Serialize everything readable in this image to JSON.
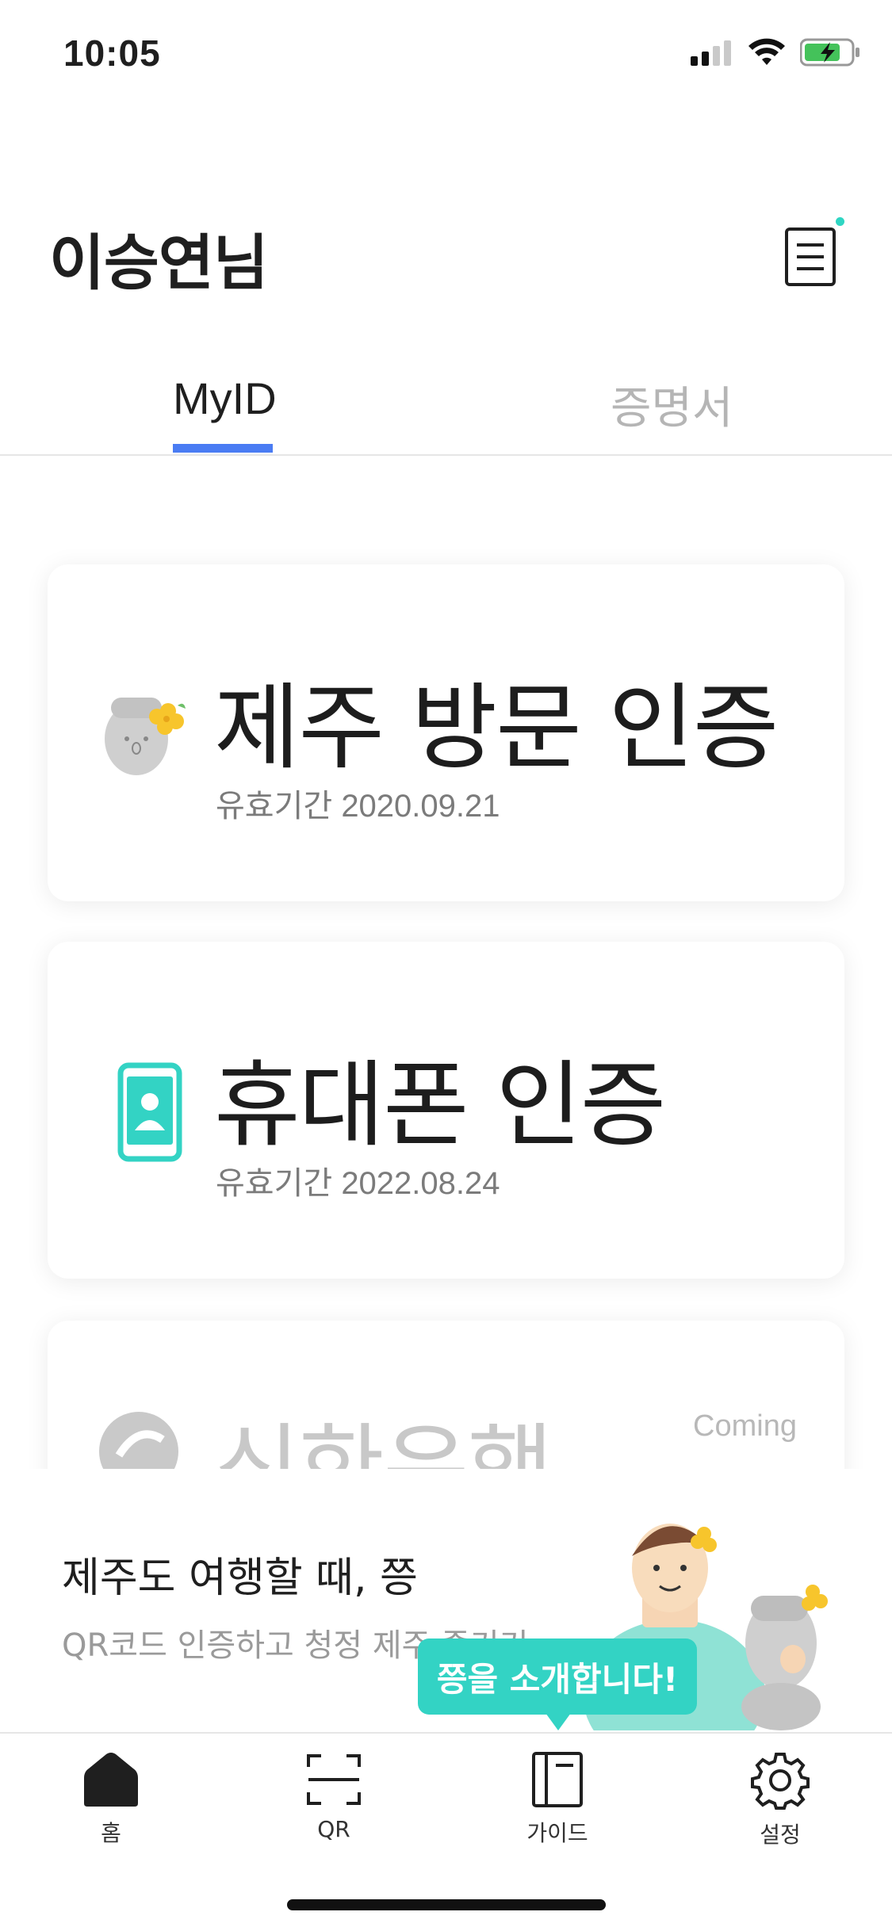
{
  "status_bar": {
    "time": "10:05",
    "icons": [
      "signal-icon",
      "wifi-icon",
      "battery-charging-icon"
    ]
  },
  "header": {
    "title": "이승연님",
    "menu_icon": "document-list-icon",
    "has_notification": true
  },
  "tabs": [
    {
      "label": "MyID",
      "active": true
    },
    {
      "label": "증명서",
      "active": false
    }
  ],
  "cards": [
    {
      "title": "제주 방문 인증",
      "subtitle": "유효기간 2020.09.21",
      "icon": "jeju-stone-statue-icon"
    },
    {
      "title": "휴대폰 인증",
      "subtitle": "유효기간 2022.08.24",
      "icon": "phone-person-icon"
    },
    {
      "title": "신한은행 ...",
      "badge": "Coming",
      "icon": "shinhan-bank-icon"
    }
  ],
  "promo": {
    "title": "제주도 여행할 때, 쯩",
    "subtitle": "QR코드 인증하고 청정 제주 즐기기",
    "tooltip": "쯩을 소개합니다!"
  },
  "bottom_nav": [
    {
      "label": "홈",
      "icon": "home-icon",
      "active": true
    },
    {
      "label": "QR",
      "icon": "qr-scan-icon",
      "active": false
    },
    {
      "label": "가이드",
      "icon": "guide-book-icon",
      "active": false
    },
    {
      "label": "설정",
      "icon": "gear-icon",
      "active": false
    }
  ],
  "colors": {
    "accent_blue": "#4a7cf3",
    "accent_teal": "#33d3c4"
  }
}
